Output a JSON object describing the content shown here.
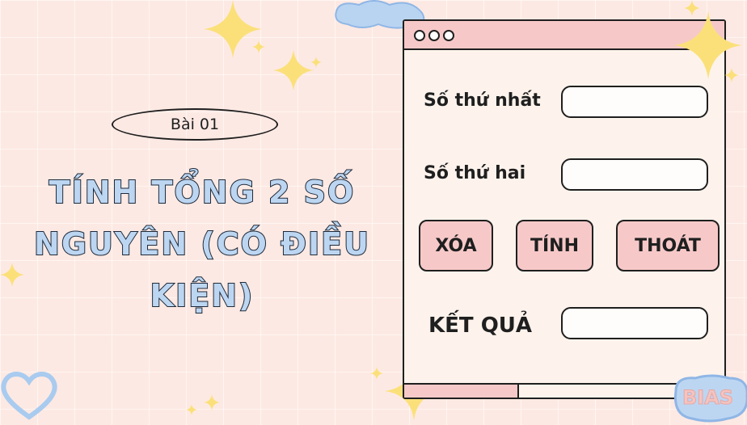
{
  "lesson_badge": "Bài 01",
  "title": "TÍNH TỔNG 2 SỐ NGUYÊN (CÓ ĐIỀU KIỆN)",
  "form": {
    "first_label": "Số thứ nhất",
    "first_value": "",
    "second_label": "Số thứ hai",
    "second_value": "",
    "result_label": "KẾT QUẢ",
    "result_value": ""
  },
  "buttons": {
    "clear": "XÓA",
    "compute": "TÍNH",
    "exit": "THOÁT"
  },
  "sticker_text": "BIAS",
  "colors": {
    "background": "#fde9e3",
    "window_bar": "#f6c9c8",
    "button_fill": "#f6c9c8",
    "title_fill": "#bcd6f2",
    "star": "#fbe07a",
    "cloud": "#a9cbef"
  }
}
